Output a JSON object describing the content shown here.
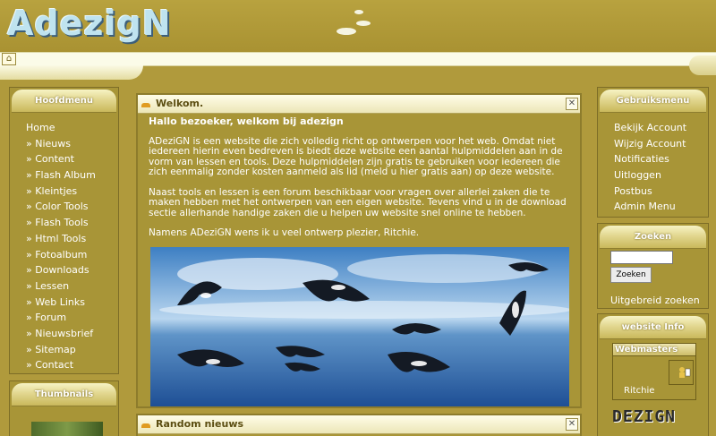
{
  "site": {
    "logo": "AdezigN"
  },
  "nav": {
    "home_icon": "home-icon"
  },
  "left_menu": {
    "title": "Hoofdmenu",
    "items": [
      "Home",
      "» Nieuws",
      "» Content",
      "» Flash Album",
      "» Kleintjes",
      "» Color Tools",
      "» Flash Tools",
      "» Html Tools",
      "» Fotoalbum",
      "» Downloads",
      "» Lessen",
      "» Web Links",
      "» Forum",
      "» Nieuwsbrief",
      "» Sitemap",
      "» Contact"
    ]
  },
  "thumbnails": {
    "title": "Thumbnails"
  },
  "welcome": {
    "title": "Welkom.",
    "greeting": "Hallo bezoeker, welkom bij adezign",
    "paragraphs": [
      "ADeziGN is een website die zich volledig richt op ontwerpen voor het web. Omdat niet iedereen hierin even bedreven is biedt deze website een aantal hulpmiddelen aan in de vorm van lessen en tools. Deze hulpmiddelen zijn gratis te gebruiken voor iedereen die zich eenmalig zonder kosten aanmeld als lid (meld u hier gratis aan) op deze website.",
      "Naast tools en lessen is een forum beschikbaar voor vragen over allerlei zaken die te maken hebben met het ontwerpen van een eigen website. Tevens vind u in de download sectie allerhande handige zaken die u helpen uw website snel online te hebben.",
      "Namens ADeziGN wens ik u veel ontwerp plezier, Ritchie."
    ]
  },
  "random_news": {
    "title": "Random nieuws"
  },
  "user_menu": {
    "title": "Gebruiksmenu",
    "items": [
      "Bekijk Account",
      "Wijzig Account",
      "Notificaties",
      "Uitloggen",
      "Postbus",
      "Admin Menu"
    ]
  },
  "search": {
    "title": "Zoeken",
    "button": "Zoeken",
    "advanced": "Uitgebreid zoeken",
    "value": ""
  },
  "website_info": {
    "title": "website Info",
    "webmasters_label": "Webmasters",
    "webmaster_name": "Ritchie",
    "logo_text": "DEZIGN"
  },
  "colors": {
    "background": "#b09a3c",
    "panel": "#a89537",
    "accent": "#e09b20"
  }
}
